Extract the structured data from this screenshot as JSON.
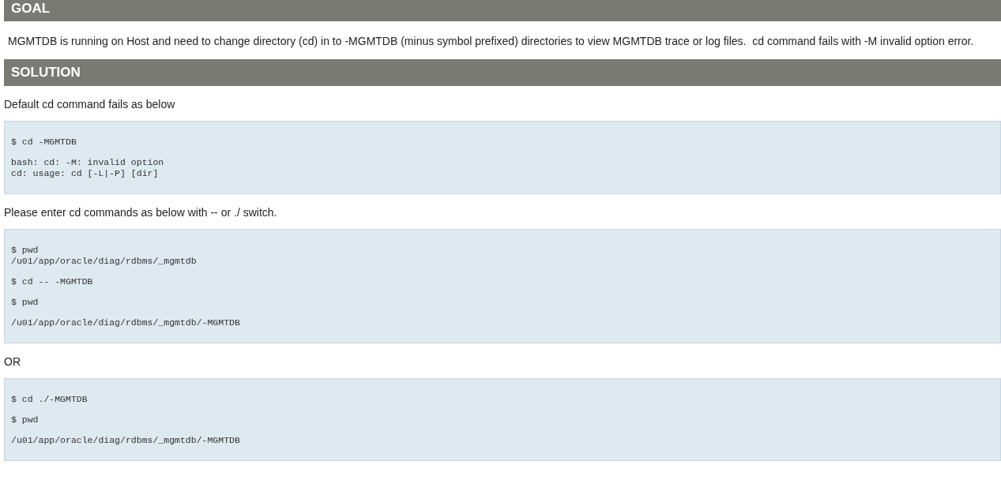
{
  "sections": [
    {
      "heading": "GOAL",
      "blocks": [
        {
          "kind": "text",
          "text": "MGMTDB is running on Host and need to change directory (cd) in to -MGMTDB (minus symbol prefixed) directories to view MGMTDB trace or log files.  cd command fails with -M invalid option error."
        }
      ]
    },
    {
      "heading": "SOLUTION",
      "blocks": [
        {
          "kind": "text",
          "text": "Default cd command fails as below"
        },
        {
          "kind": "code",
          "groups": [
            [
              "$ cd -MGMTDB"
            ],
            [
              "bash: cd: -M: invalid option",
              "cd: usage: cd [-L|-P] [dir]"
            ]
          ]
        },
        {
          "kind": "text",
          "text": "Please enter cd commands as below with -- or ./ switch."
        },
        {
          "kind": "code",
          "groups": [
            [
              "$ pwd",
              "/u01/app/oracle/diag/rdbms/_mgmtdb"
            ],
            [
              "$ cd -- -MGMTDB"
            ],
            [
              "$ pwd"
            ],
            [
              "/u01/app/oracle/diag/rdbms/_mgmtdb/-MGMTDB"
            ]
          ]
        },
        {
          "kind": "text",
          "text": "OR"
        },
        {
          "kind": "code",
          "groups": [
            [
              "$ cd ./-MGMTDB"
            ],
            [
              "$ pwd"
            ],
            [
              "/u01/app/oracle/diag/rdbms/_mgmtdb/-MGMTDB"
            ]
          ]
        }
      ]
    }
  ]
}
